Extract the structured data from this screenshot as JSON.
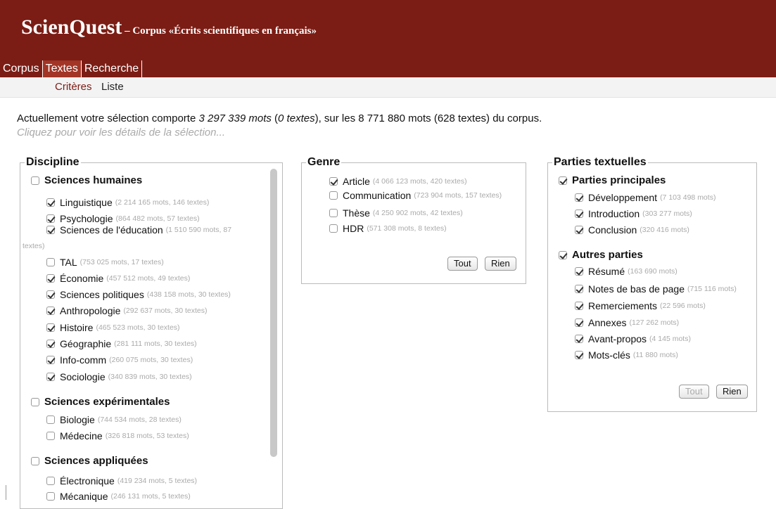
{
  "header": {
    "title": "ScienQuest",
    "subtitle": " – Corpus «Écrits scientifiques en français»",
    "tabs": [
      "Corpus",
      "Textes",
      "Recherche"
    ]
  },
  "subtabs": [
    "Critères",
    "Liste"
  ],
  "selection": {
    "prefix": "Actuellement votre sélection comporte ",
    "mots": "3 297 339 mots",
    "textes": "0 textes",
    "suffix": ", sur les 8 771 880 mots (628 textes) du corpus.",
    "hint": "Cliquez pour voir les détails de la sélection..."
  },
  "discipline": {
    "legend": "Discipline",
    "groups": [
      {
        "label": "Sciences humaines",
        "checked": false,
        "items": [
          {
            "label": "Linguistique",
            "count": "(2 214 165 mots, 146 textes)",
            "checked": true
          },
          {
            "label": "Psychologie",
            "count": "(864 482 mots, 57 textes)",
            "checked": true
          },
          {
            "label": "Sciences de l'éducation",
            "count": "(1 510 590 mots, 87",
            "checked": true
          },
          {
            "label": "TAL",
            "count": "(753 025 mots, 17 textes)",
            "checked": false
          },
          {
            "label": "Économie",
            "count": "(457 512 mots, 49 textes)",
            "checked": true
          },
          {
            "label": "Sciences politiques",
            "count": "(438 158 mots, 30 textes)",
            "checked": true
          },
          {
            "label": "Anthropologie",
            "count": "(292 637 mots, 30 textes)",
            "checked": true
          },
          {
            "label": "Histoire",
            "count": "(465 523 mots, 30 textes)",
            "checked": true
          },
          {
            "label": "Géographie",
            "count": "(281 111 mots, 30 textes)",
            "checked": true
          },
          {
            "label": "Info-comm",
            "count": "(260 075 mots, 30 textes)",
            "checked": true
          },
          {
            "label": "Sociologie",
            "count": "(340 839 mots, 30 textes)",
            "checked": true
          }
        ]
      },
      {
        "label": "Sciences expérimentales",
        "checked": false,
        "items": [
          {
            "label": "Biologie",
            "count": "(744 534 mots, 28 textes)",
            "checked": false
          },
          {
            "label": "Médecine",
            "count": "(326 818 mots, 53 textes)",
            "checked": false
          }
        ]
      },
      {
        "label": "Sciences appliquées",
        "checked": false,
        "items": [
          {
            "label": "Électronique",
            "count": "(419 234 mots, 5 textes)",
            "checked": false
          },
          {
            "label": "Mécanique",
            "count": "(246 131 mots, 5 textes)",
            "checked": false
          }
        ]
      }
    ],
    "wrap_text": "textes)"
  },
  "genre": {
    "legend": "Genre",
    "items": [
      {
        "label": "Article",
        "count": "(4 066 123 mots, 420 textes)",
        "checked": true
      },
      {
        "label": "Communication",
        "count": "(723 904 mots, 157 textes)",
        "checked": false
      },
      {
        "label": "Thèse",
        "count": "(4 250 902 mots, 42 textes)",
        "checked": false
      },
      {
        "label": "HDR",
        "count": "(571 308 mots, 8 textes)",
        "checked": false
      }
    ],
    "btn_all": "Tout",
    "btn_none": "Rien"
  },
  "parties": {
    "legend": "Parties textuelles",
    "groups": [
      {
        "label": "Parties principales",
        "checked": true,
        "items": [
          {
            "label": "Développement",
            "count": "(7 103 498 mots)",
            "checked": true
          },
          {
            "label": "Introduction",
            "count": "(303 277 mots)",
            "checked": true
          },
          {
            "label": "Conclusion",
            "count": "(320 416 mots)",
            "checked": true
          }
        ]
      },
      {
        "label": "Autres parties",
        "checked": true,
        "items": [
          {
            "label": "Résumé",
            "count": "(163 690 mots)",
            "checked": true
          },
          {
            "label": "Notes de bas de page",
            "count": "(715 116 mots)",
            "checked": true
          },
          {
            "label": "Remerciements",
            "count": "(22 596 mots)",
            "checked": true
          },
          {
            "label": "Annexes",
            "count": "(127 262 mots)",
            "checked": true
          },
          {
            "label": "Avant-propos",
            "count": "(4 145 mots)",
            "checked": true
          },
          {
            "label": "Mots-clés",
            "count": "(11 880 mots)",
            "checked": true
          }
        ]
      }
    ],
    "btn_all": "Tout",
    "btn_none": "Rien"
  }
}
